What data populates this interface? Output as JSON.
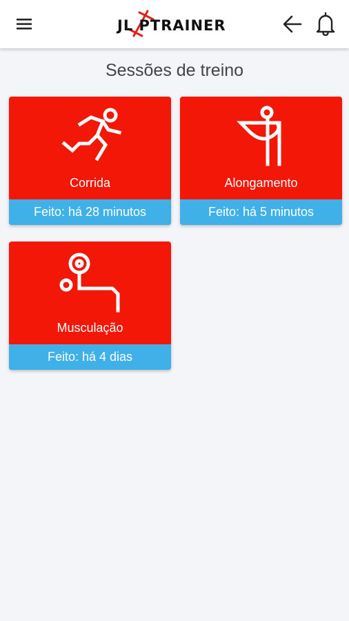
{
  "appbar": {
    "logo_text": "JL PTRAINER",
    "menu_icon": "hamburger-menu-icon",
    "back_icon": "arrow-left-icon",
    "notifications_icon": "bell-icon"
  },
  "page": {
    "title": "Sessões de treino"
  },
  "sessions": [
    {
      "label": "Corrida",
      "status": "Feito: há 28 minutos",
      "icon": "running-person-icon"
    },
    {
      "label": "Alongamento",
      "status": "Feito: há 5 minutos",
      "icon": "stretching-person-icon"
    },
    {
      "label": "Musculação",
      "status": "Feito: há 4 dias",
      "icon": "weightlifting-person-icon"
    }
  ],
  "colors": {
    "card_red": "#f21707",
    "footer_blue": "#3fb0e8",
    "background": "#f4f5f9"
  }
}
